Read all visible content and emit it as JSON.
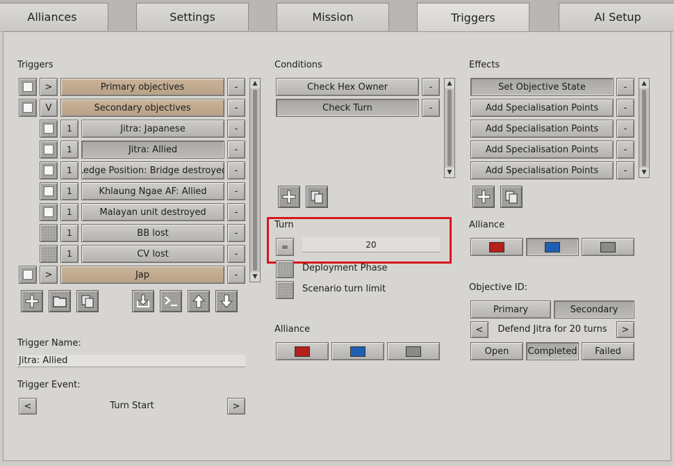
{
  "tabs": [
    "Alliances",
    "Settings",
    "Mission",
    "Triggers",
    "AI Setup"
  ],
  "triggers": {
    "header": "Triggers",
    "items": [
      {
        "expander": ">",
        "label": "Primary objectives",
        "remove": "-"
      },
      {
        "expander": "V",
        "label": "Secondary objectives",
        "remove": "-"
      },
      {
        "num": "1",
        "label": "Jitra: Japanese",
        "remove": "-"
      },
      {
        "num": "1",
        "label": "Jitra: Allied",
        "remove": "-"
      },
      {
        "num": "1",
        "label": "Ledge Position: Bridge destroyed",
        "remove": "-"
      },
      {
        "num": "1",
        "label": "Khlaung Ngae AF: Allied",
        "remove": "-"
      },
      {
        "num": "1",
        "label": "Malayan unit destroyed",
        "remove": "-"
      },
      {
        "num": "1",
        "label": "BB lost",
        "remove": "-"
      },
      {
        "num": "1",
        "label": "CV lost",
        "remove": "-"
      },
      {
        "expander": ">",
        "label": "Jap",
        "remove": "-"
      }
    ],
    "toolbar_icons": [
      "add-icon",
      "folder-icon",
      "copy-icon",
      "import-icon",
      "console-icon",
      "arrow-up-icon",
      "arrow-down-icon"
    ]
  },
  "trigger_name": {
    "label": "Trigger Name:",
    "value": "Jitra: Allied"
  },
  "trigger_event": {
    "label": "Trigger Event:",
    "prev": "<",
    "value": "Turn Start",
    "next": ">"
  },
  "conditions": {
    "header": "Conditions",
    "items": [
      {
        "label": "Check Hex Owner",
        "remove": "-"
      },
      {
        "label": "Check Turn",
        "remove": "-"
      }
    ],
    "toolbar_icons": [
      "add-icon",
      "copy-icon"
    ]
  },
  "turn": {
    "label": "Turn",
    "operator": "=",
    "value": "20",
    "options": [
      {
        "label": "Deployment Phase"
      },
      {
        "label": "Scenario turn limit"
      }
    ]
  },
  "condition_alliance": {
    "label": "Alliance",
    "colors": [
      "#b4201c",
      "#1f5fb3",
      "#8a8a8a"
    ]
  },
  "effects": {
    "header": "Effects",
    "items": [
      {
        "label": "Set Objective State",
        "remove": "-"
      },
      {
        "label": "Add Specialisation Points",
        "remove": "-"
      },
      {
        "label": "Add Specialisation Points",
        "remove": "-"
      },
      {
        "label": "Add Specialisation Points",
        "remove": "-"
      },
      {
        "label": "Add Specialisation Points",
        "remove": "-"
      }
    ],
    "toolbar_icons": [
      "add-icon",
      "copy-icon"
    ]
  },
  "effect_alliance": {
    "label": "Alliance",
    "colors": [
      "#b4201c",
      "#1f5fb3",
      "#8a8a8a"
    ]
  },
  "objective": {
    "label": "Objective ID:",
    "types": [
      "Primary",
      "Secondary"
    ],
    "prev": "<",
    "current": "Defend Jitra for 20 turns",
    "next": ">",
    "states": [
      "Open",
      "Completed",
      "Failed"
    ]
  },
  "scroll": {
    "up": "▲",
    "down": "▼"
  }
}
